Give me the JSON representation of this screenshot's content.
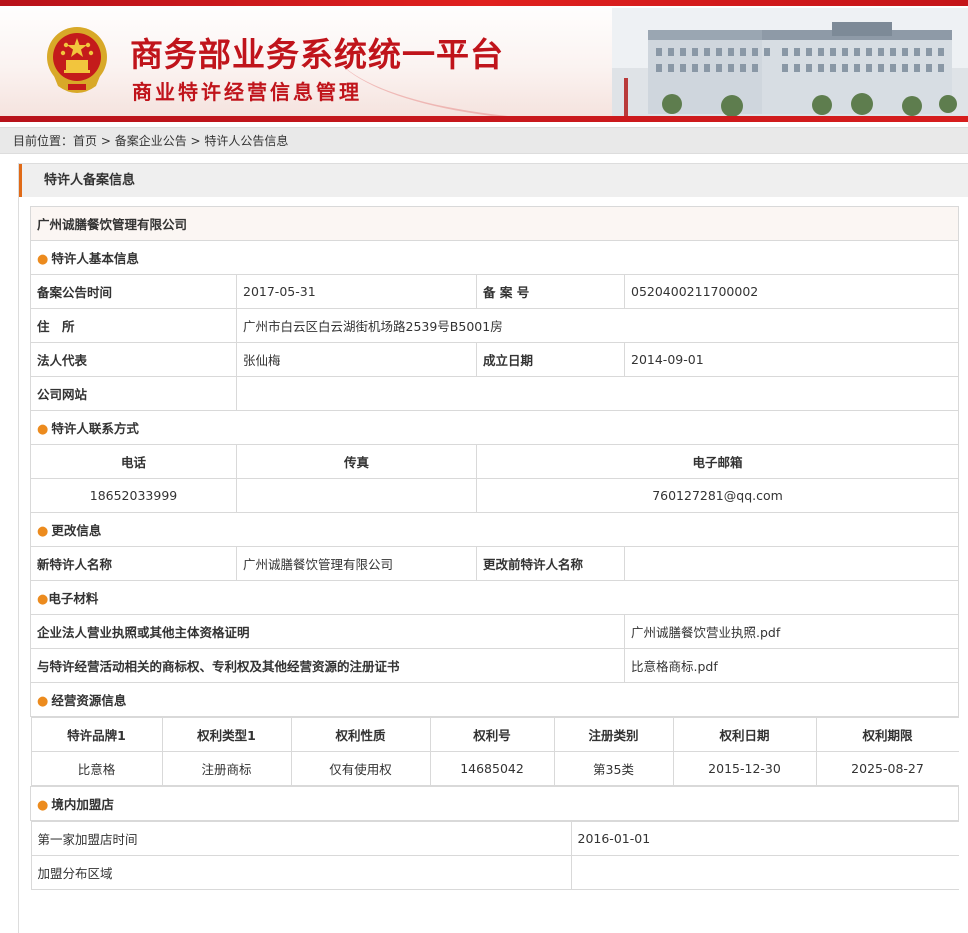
{
  "header": {
    "title": "商务部业务系统统一平台",
    "subtitle": "商业特许经营信息管理"
  },
  "breadcrumb": {
    "prefix": "目前位置：",
    "items": [
      "首页",
      "备案企业公告",
      "特许人公告信息"
    ],
    "separator": " > "
  },
  "section_title": "特许人备案信息",
  "company_name": "广州诚膳餐饮管理有限公司",
  "basic": {
    "heading": "特许人基本信息",
    "filing_time_label": "备案公告时间",
    "filing_time": "2017-05-31",
    "filing_no_label": "备 案 号",
    "filing_no": "0520400211700002",
    "address_label": "住　所",
    "address": "广州市白云区白云湖街机场路2539号B5001房",
    "legal_rep_label": "法人代表",
    "legal_rep": "张仙梅",
    "founded_label": "成立日期",
    "founded": "2014-09-01",
    "website_label": "公司网站",
    "website": ""
  },
  "contact": {
    "heading": "特许人联系方式",
    "headers": [
      "电话",
      "传真",
      "电子邮箱"
    ],
    "values": [
      "18652033999",
      "",
      "760127281@qq.com"
    ]
  },
  "change": {
    "heading": "更改信息",
    "new_name_label": "新特许人名称",
    "new_name": "广州诚膳餐饮管理有限公司",
    "old_name_label": "更改前特许人名称",
    "old_name": ""
  },
  "materials": {
    "heading": "电子材料",
    "items": [
      {
        "label": "企业法人营业执照或其他主体资格证明",
        "file": "广州诚膳餐饮营业执照.pdf"
      },
      {
        "label": "与特许经营活动相关的商标权、专利权及其他经营资源的注册证书",
        "file": "比意格商标.pdf"
      }
    ]
  },
  "resources": {
    "heading": "经营资源信息",
    "headers": [
      "特许品牌1",
      "权利类型1",
      "权利性质",
      "权利号",
      "注册类别",
      "权利日期",
      "权利期限"
    ],
    "rows": [
      [
        "比意格",
        "注册商标",
        "仅有使用权",
        "14685042",
        "第35类",
        "2015-12-30",
        "2025-08-27"
      ]
    ]
  },
  "stores": {
    "heading": "境内加盟店",
    "first_store_label": "第一家加盟店时间",
    "first_store": "2016-01-01",
    "area_label": "加盟分布区域",
    "area": ""
  },
  "colors": {
    "brand_red": "#c0141b",
    "accent_orange": "#e06a17",
    "link_red": "#d32a2a"
  }
}
